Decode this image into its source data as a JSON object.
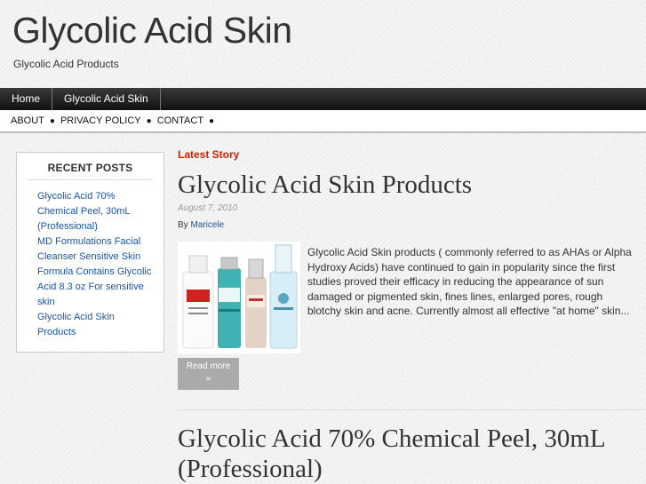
{
  "site": {
    "title": "Glycolic Acid Skin",
    "description": "Glycolic Acid Products"
  },
  "nav": {
    "items": [
      "Home",
      "Glycolic Acid Skin"
    ]
  },
  "subnav": {
    "items": [
      "ABOUT",
      "PRIVACY POLICY",
      "CONTACT"
    ],
    "separator": "●"
  },
  "sidebar": {
    "title": "RECENT POSTS",
    "posts": [
      "Glycolic Acid 70% Chemical Peel, 30mL (Professional)",
      "MD Formulations Facial Cleanser Sensitive Skin Formula Contains Glycolic Acid 8.3 oz For sensitive skin",
      "Glycolic Acid Skin Products"
    ]
  },
  "main": {
    "latest_label": "Latest Story",
    "post": {
      "title": "Glycolic Acid Skin Products",
      "date": "August 7, 2010",
      "by_label": "By",
      "author": "Maricele",
      "excerpt": "Glycolic Acid Skin products ( commonly referred to as AHAs or Alpha Hydroxy Acids) have continued to gain in popularity since the first studies proved their efficacy in reducing the appearance of sun damaged or pigmented skin, fines lines, enlarged pores, rough blotchy skin and acne. Currently almost all effective \"at home\" skin...",
      "read_more": "Read more",
      "read_more_arrow": "»"
    },
    "next_post": {
      "title": "Glycolic Acid 70% Chemical Peel, 30mL (Professional)"
    }
  },
  "colors": {
    "accent_red": "#cc2200",
    "link_blue": "#1a55aa",
    "nav_dark": "#1a1a1a"
  }
}
